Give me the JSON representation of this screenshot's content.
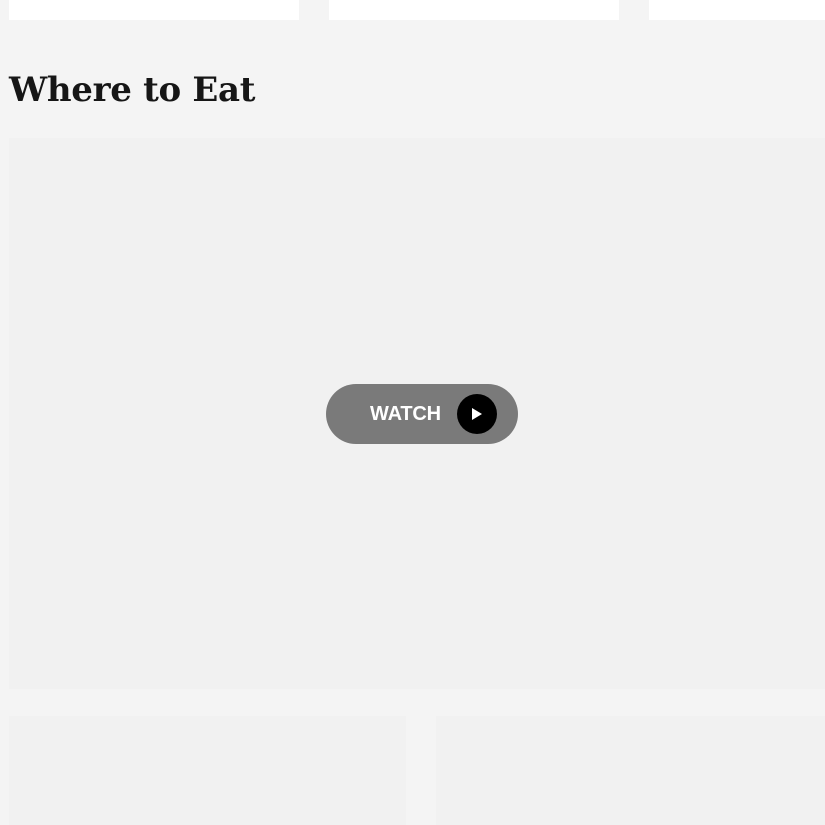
{
  "section": {
    "title": "Where to Eat"
  },
  "video": {
    "watch_label": "WATCH",
    "icon": "play-icon"
  },
  "colors": {
    "page_background": "#f4f4f4",
    "panel_background": "#f1f1f1",
    "watch_button": "#7a7a7a",
    "play_circle": "#000000",
    "title_text": "#161616"
  }
}
